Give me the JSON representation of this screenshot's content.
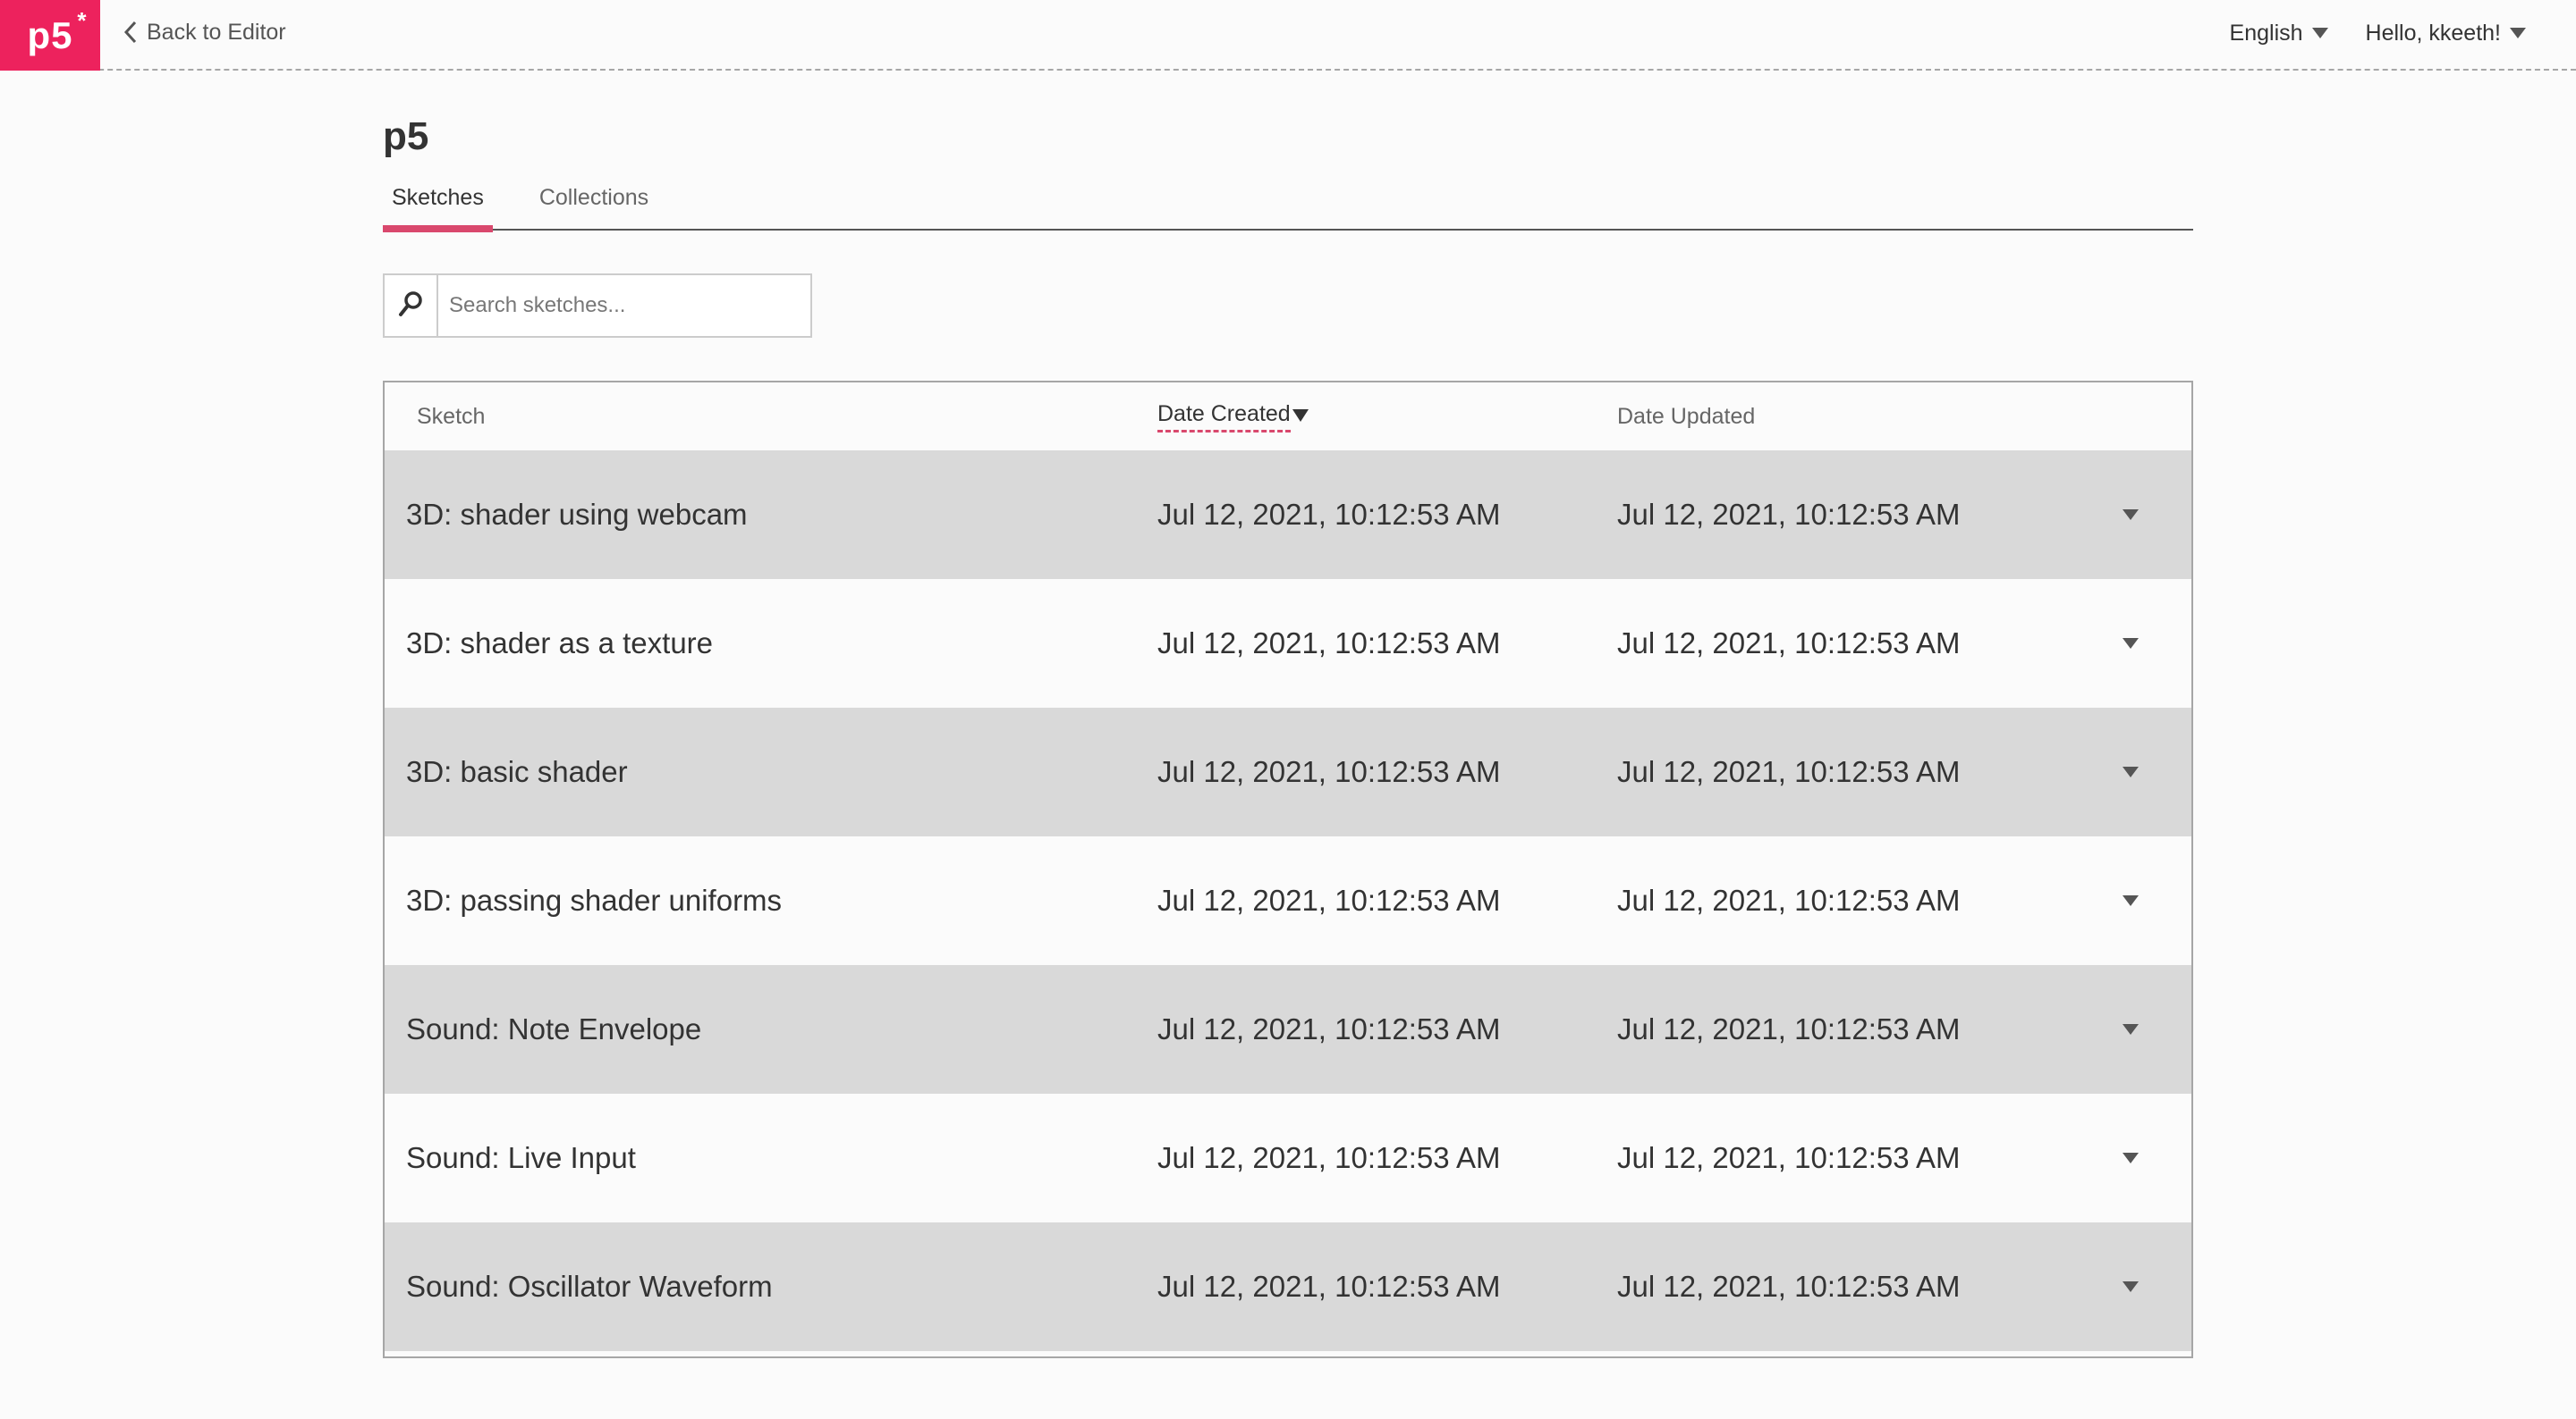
{
  "nav": {
    "logo": "p5",
    "logo_mark": "*",
    "back_label": "Back to Editor",
    "language": "English",
    "user_greeting": "Hello, kkeeth!"
  },
  "profile": {
    "owner": "p5"
  },
  "tabs": [
    {
      "label": "Sketches",
      "active": true
    },
    {
      "label": "Collections",
      "active": false
    }
  ],
  "search": {
    "placeholder": "Search sketches..."
  },
  "table": {
    "headers": {
      "sketch": "Sketch",
      "date_created": "Date Created",
      "date_updated": "Date Updated"
    },
    "rows": [
      {
        "name": "3D: shader using webcam",
        "created": "Jul 12, 2021, 10:12:53 AM",
        "updated": "Jul 12, 2021, 10:12:53 AM"
      },
      {
        "name": "3D: shader as a texture",
        "created": "Jul 12, 2021, 10:12:53 AM",
        "updated": "Jul 12, 2021, 10:12:53 AM"
      },
      {
        "name": "3D: basic shader",
        "created": "Jul 12, 2021, 10:12:53 AM",
        "updated": "Jul 12, 2021, 10:12:53 AM"
      },
      {
        "name": "3D: passing shader uniforms",
        "created": "Jul 12, 2021, 10:12:53 AM",
        "updated": "Jul 12, 2021, 10:12:53 AM"
      },
      {
        "name": "Sound: Note Envelope",
        "created": "Jul 12, 2021, 10:12:53 AM",
        "updated": "Jul 12, 2021, 10:12:53 AM"
      },
      {
        "name": "Sound: Live Input",
        "created": "Jul 12, 2021, 10:12:53 AM",
        "updated": "Jul 12, 2021, 10:12:53 AM"
      },
      {
        "name": "Sound: Oscillator Waveform",
        "created": "Jul 12, 2021, 10:12:53 AM",
        "updated": "Jul 12, 2021, 10:12:53 AM"
      }
    ]
  },
  "colors": {
    "brand": "#ed225d",
    "tab_underline": "#d9486d",
    "row_shaded": "#d9d9d9",
    "background": "#fbfbfb"
  }
}
